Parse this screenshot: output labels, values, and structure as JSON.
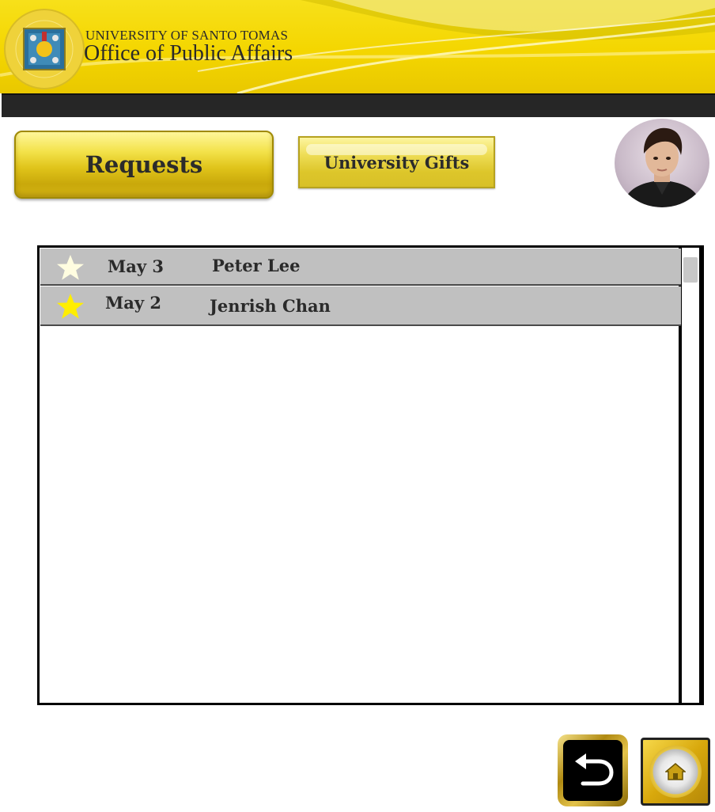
{
  "header": {
    "university": "UNIVERSITY OF SANTO TOMAS",
    "office": "Office of Public Affairs",
    "seal_icon": "university-seal-icon"
  },
  "tabs": [
    {
      "label": "Requests",
      "active": true
    },
    {
      "label": "University Gifts",
      "active": false
    }
  ],
  "user": {
    "avatar_icon": "user-photo"
  },
  "requests": [
    {
      "date": "May 3",
      "name": "Peter Lee",
      "starred": true,
      "star_color": "#fffde0"
    },
    {
      "date": "May 2",
      "name": "Jenrish Chan",
      "starred": true,
      "star_color": "#ffee00"
    }
  ],
  "footer": {
    "back_icon": "back-arrow-icon",
    "home_icon": "home-icon"
  },
  "colors": {
    "header_yellow": "#f4d600",
    "dark_bar": "#262626",
    "row_gray": "#c0c0c0"
  }
}
